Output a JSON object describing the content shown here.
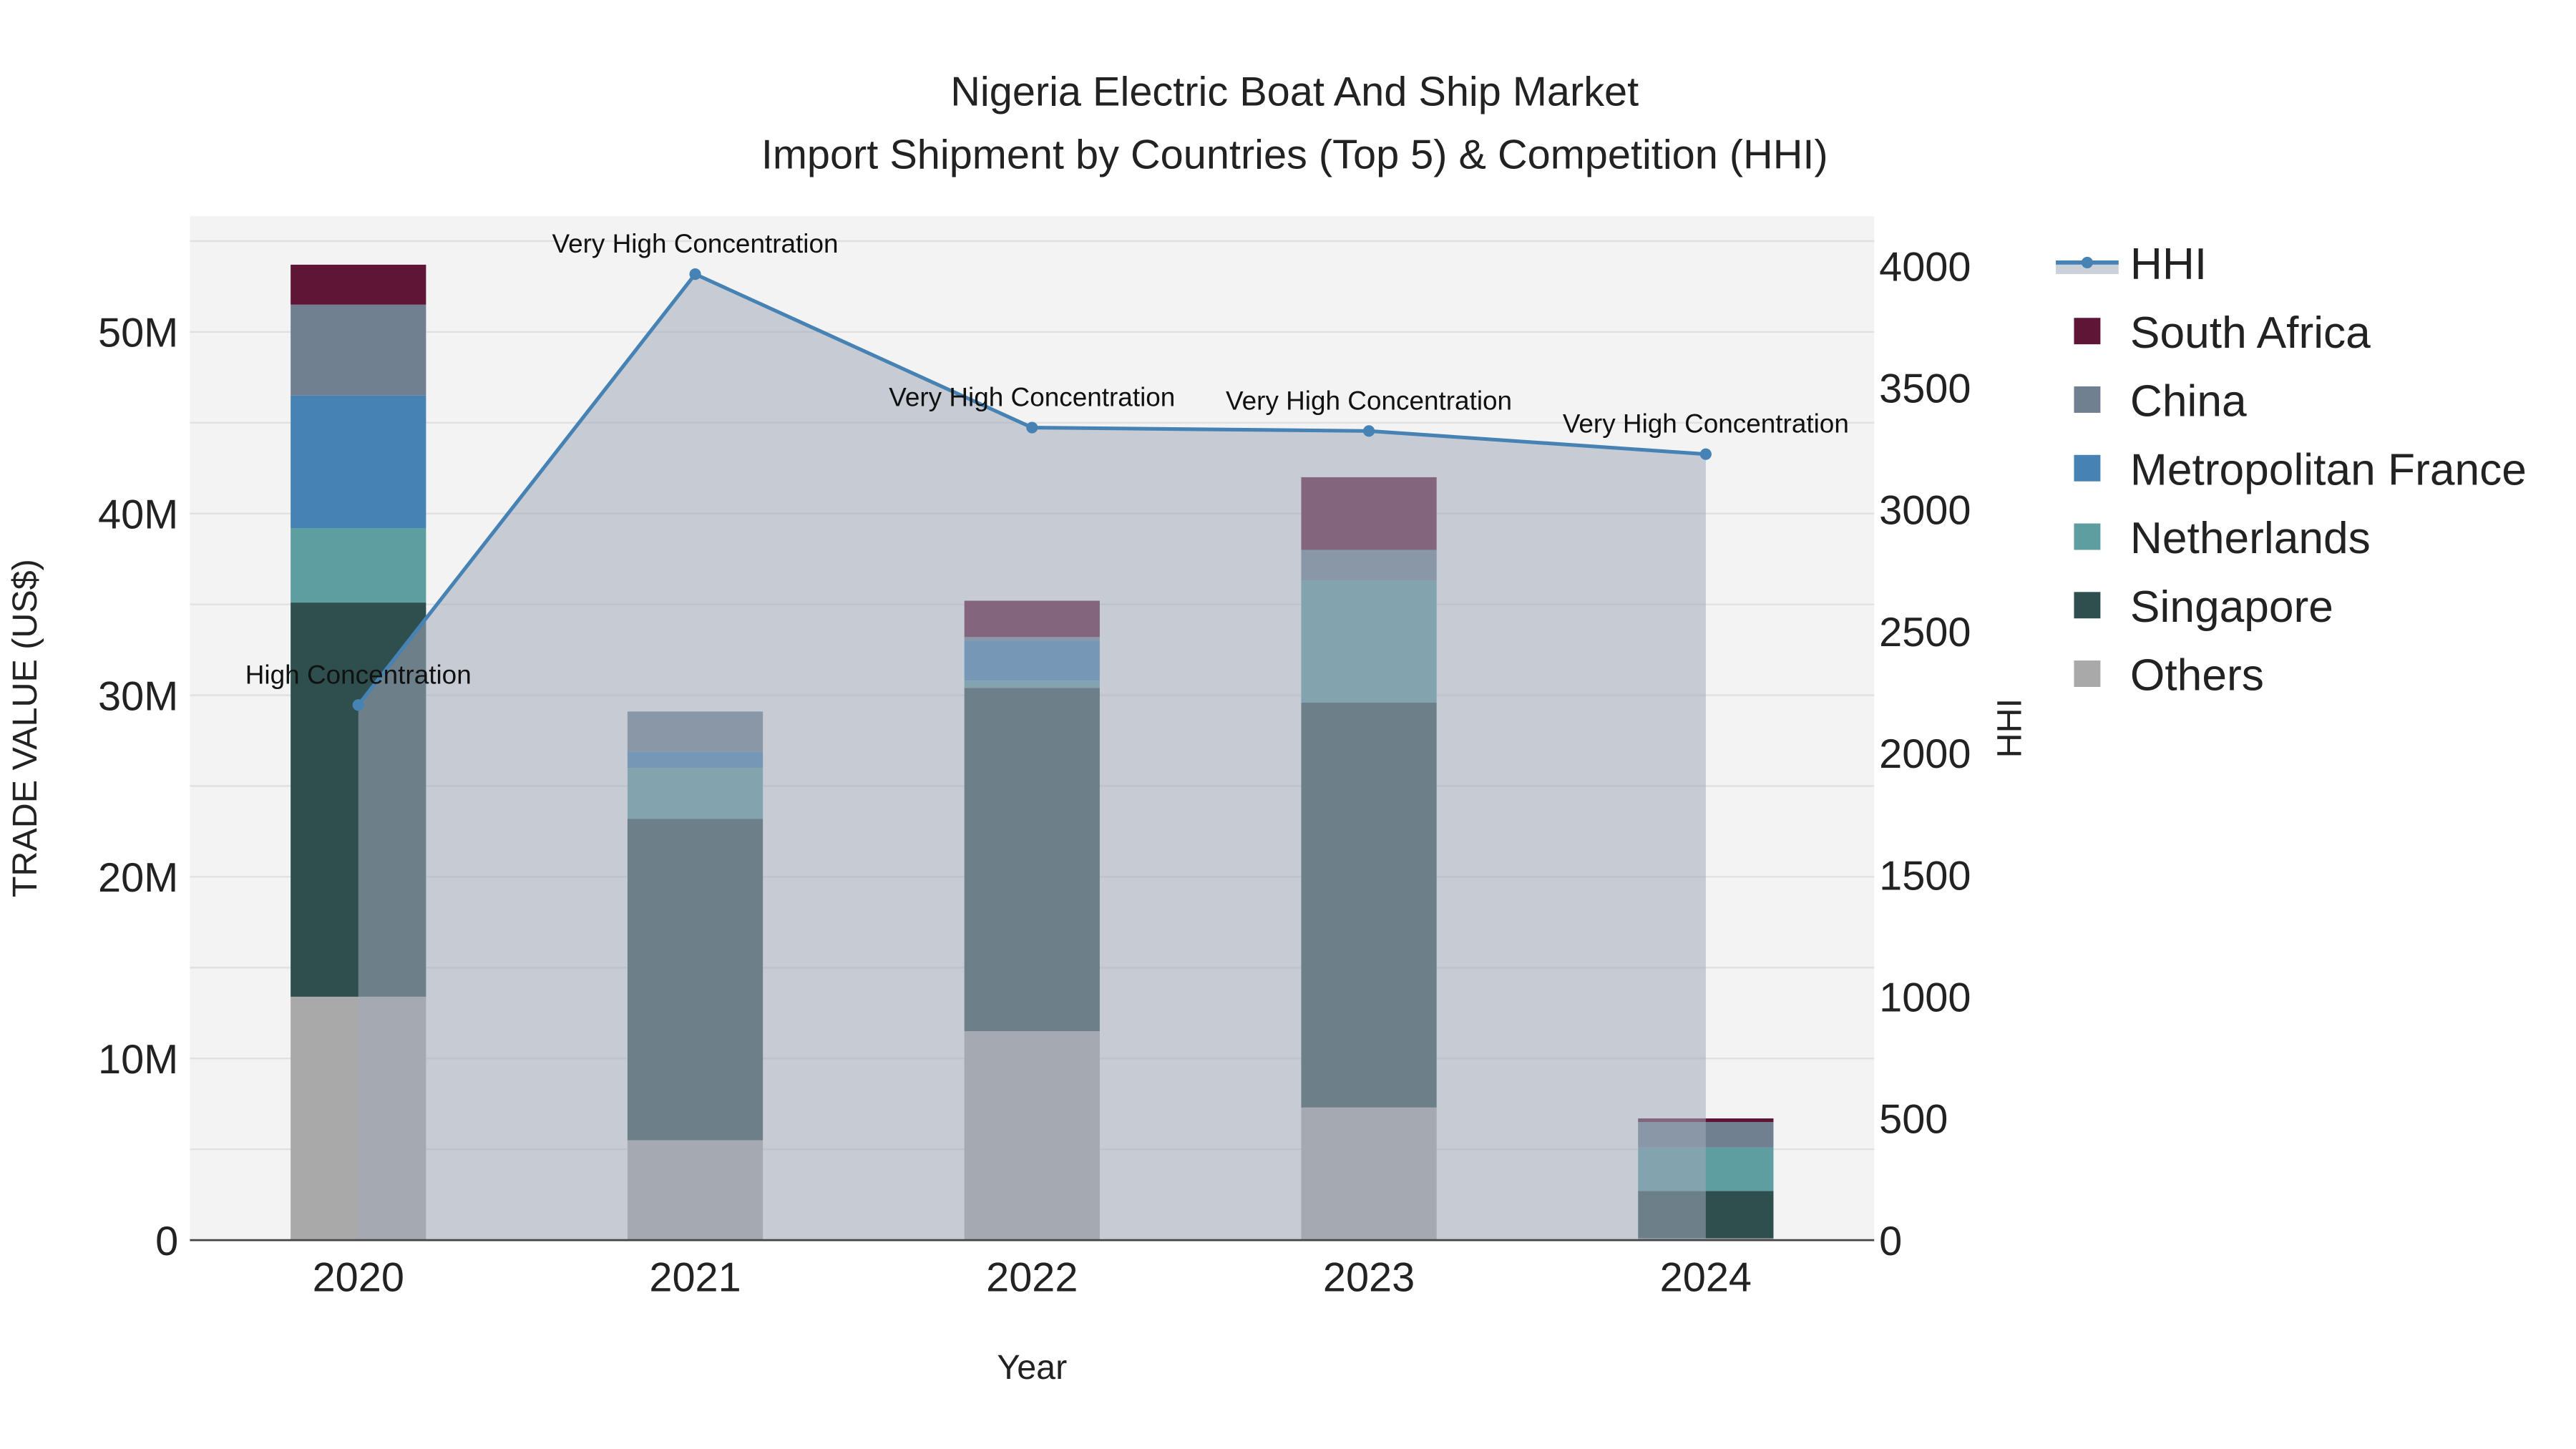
{
  "chart_data": {
    "type": "bar",
    "stacked": true,
    "title_line1": "Nigeria Electric Boat And Ship Market",
    "title_line2": "Import Shipment by Countries (Top 5) & Competition (HHI)",
    "xlabel": "Year",
    "ylabel": "TRADE VALUE (US$)",
    "y2label": "HHI",
    "categories": [
      "2020",
      "2021",
      "2022",
      "2023",
      "2024"
    ],
    "ylim": [
      0,
      55
    ],
    "y_unit": "M",
    "yticks": [
      0,
      10,
      20,
      30,
      40,
      50
    ],
    "ytick_labels": [
      "0",
      "10M",
      "20M",
      "30M",
      "40M",
      "50M"
    ],
    "y2lim": [
      0,
      4200
    ],
    "y2ticks": [
      "0",
      "500",
      "1000",
      "1500",
      "2000",
      "2500",
      "3000",
      "3500",
      "4000"
    ],
    "series": [
      {
        "name": "Others",
        "color": "#a9a9a9",
        "values": [
          13.4,
          5.5,
          11.5,
          7.3,
          0.1
        ]
      },
      {
        "name": "Singapore",
        "color": "#2f4f4f",
        "values": [
          21.7,
          17.7,
          18.9,
          22.3,
          2.6
        ]
      },
      {
        "name": "Netherlands",
        "color": "#5f9ea0",
        "values": [
          4.1,
          2.8,
          0.4,
          6.7,
          2.4
        ]
      },
      {
        "name": "Metropolitan France",
        "color": "#4682b4",
        "values": [
          7.3,
          0.9,
          2.2,
          0,
          0
        ]
      },
      {
        "name": "China",
        "color": "#708090",
        "values": [
          5.0,
          2.2,
          0.2,
          1.7,
          1.4
        ]
      },
      {
        "name": "South Africa",
        "color": "#5f1536",
        "values": [
          2.2,
          0,
          2.0,
          4.0,
          0.2
        ]
      }
    ],
    "hhi": {
      "name": "HHI",
      "color": "#4682b4",
      "values": [
        2197,
        3966,
        3336,
        3322,
        3227
      ],
      "labels": [
        "High Concentration",
        "Very High Concentration",
        "Very High Concentration",
        "Very High Concentration",
        "Very High Concentration"
      ]
    },
    "legend_order": [
      "HHI",
      "South Africa",
      "China",
      "Metropolitan France",
      "Netherlands",
      "Singapore",
      "Others"
    ],
    "legend_position": "right",
    "grid": true
  }
}
